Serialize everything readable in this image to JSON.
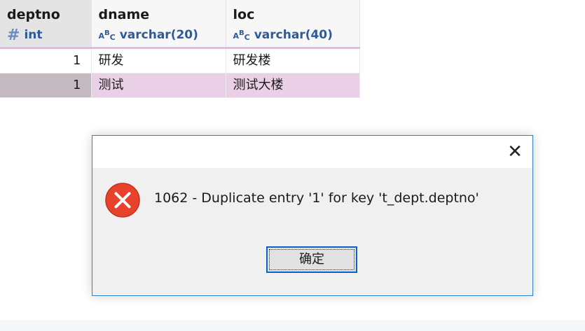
{
  "grid": {
    "columns": [
      {
        "name": "deptno",
        "type": "int",
        "icon": "hash-icon"
      },
      {
        "name": "dname",
        "type": "varchar(20)",
        "icon": "text-type-icon"
      },
      {
        "name": "loc",
        "type": "varchar(40)",
        "icon": "text-type-icon"
      }
    ],
    "rows": [
      {
        "deptno": "1",
        "dname": "研发",
        "loc": "研发楼",
        "selected": false
      },
      {
        "deptno": "1",
        "dname": "测试",
        "loc": "测试大楼",
        "selected": true
      }
    ]
  },
  "dialog": {
    "message": "1062 - Duplicate entry '1' for key 't_dept.deptno'",
    "ok_label": "确定",
    "close_glyph": "✕",
    "icon": "error-icon"
  },
  "colors": {
    "header_border": "#e9b7dd",
    "selected_row": "#ead0e6",
    "type_text": "#2f5a99",
    "dialog_border": "#2f7fd0",
    "error_red": "#e8412c"
  }
}
